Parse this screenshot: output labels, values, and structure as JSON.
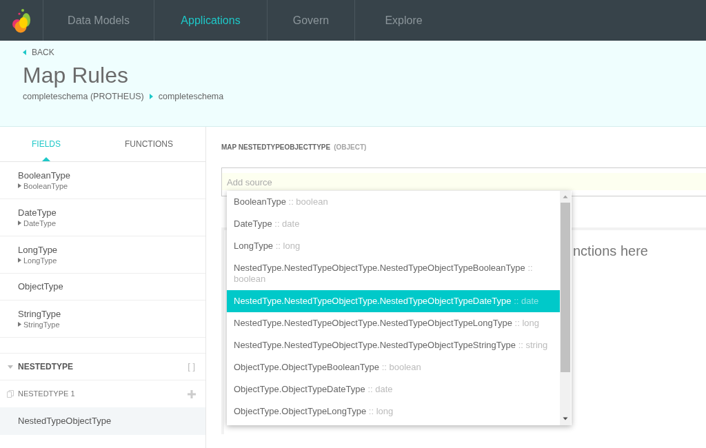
{
  "nav": {
    "items": [
      {
        "label": "Data Models",
        "selected": false
      },
      {
        "label": "Applications",
        "selected": true
      },
      {
        "label": "Govern",
        "selected": false
      },
      {
        "label": "Explore",
        "selected": false
      }
    ]
  },
  "header": {
    "back": "BACK",
    "title": "Map Rules",
    "breadcrumb": [
      "completeschema (PROTHEUS)",
      "completeschema"
    ]
  },
  "sidebar": {
    "tabs": [
      {
        "label": "FIELDS",
        "selected": true
      },
      {
        "label": "FUNCTIONS",
        "selected": false
      }
    ],
    "fields": [
      {
        "name": "BooleanType",
        "path": "BooleanType"
      },
      {
        "name": "DateType",
        "path": "DateType"
      },
      {
        "name": "LongType",
        "path": "LongType"
      },
      {
        "name": "ObjectType"
      },
      {
        "name": "StringType",
        "path": "StringType"
      }
    ],
    "groups": [
      {
        "title": "NESTEDTYPE",
        "expanded": true,
        "array_marker": "[ ]",
        "children": [
          {
            "label": "NESTEDTYPE 1",
            "children": [
              {
                "name": "NestedTypeObjectType",
                "selected": true
              }
            ]
          }
        ]
      }
    ]
  },
  "mapping": {
    "label": "MAP NESTEDTYPEOBJECTTYPE",
    "type_label": "(OBJECT)",
    "source_field": {
      "placeholder": "Add source"
    },
    "drop_zone": {
      "text": "nctions here"
    },
    "suggestions": [
      {
        "name": "BooleanType",
        "type_label": ":: boolean",
        "selected": false
      },
      {
        "name": "DateType",
        "type_label": ":: date",
        "selected": false
      },
      {
        "name": "LongType",
        "type_label": ":: long",
        "selected": false
      },
      {
        "name": "NestedType.NestedTypeObjectType.NestedTypeObjectTypeBooleanType",
        "type_label": ":: boolean",
        "selected": false
      },
      {
        "name": "NestedType.NestedTypeObjectType.NestedTypeObjectTypeDateType",
        "type_label": ":: date",
        "selected": true
      },
      {
        "name": "NestedType.NestedTypeObjectType.NestedTypeObjectTypeLongType",
        "type_label": ":: long",
        "selected": false
      },
      {
        "name": "NestedType.NestedTypeObjectType.NestedTypeObjectTypeStringType",
        "type_label": ":: string",
        "selected": false
      },
      {
        "name": "ObjectType.ObjectTypeBooleanType",
        "type_label": ":: boolean",
        "selected": false
      },
      {
        "name": "ObjectType.ObjectTypeDateType",
        "type_label": ":: date",
        "selected": false
      },
      {
        "name": "ObjectType.ObjectTypeLongType",
        "type_label": ":: long",
        "selected": false
      }
    ]
  }
}
